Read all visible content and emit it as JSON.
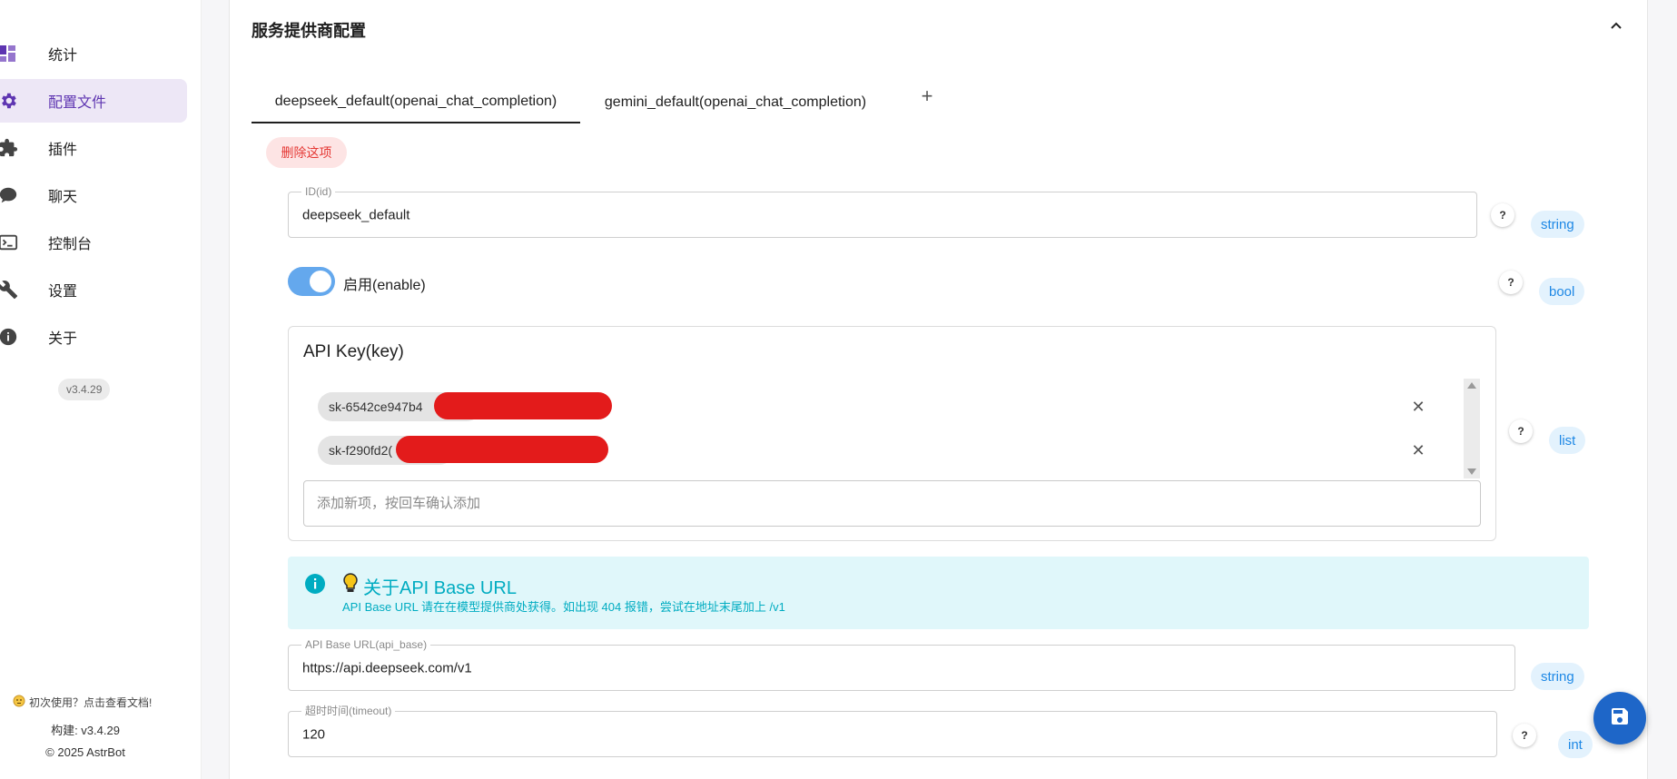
{
  "sidebar": {
    "items": [
      {
        "label": "统计",
        "icon": "dashboard-icon"
      },
      {
        "label": "配置文件",
        "icon": "gear-icon"
      },
      {
        "label": "插件",
        "icon": "puzzle-icon"
      },
      {
        "label": "聊天",
        "icon": "chat-bubble-icon"
      },
      {
        "label": "控制台",
        "icon": "terminal-icon"
      },
      {
        "label": "设置",
        "icon": "wrench-icon"
      },
      {
        "label": "关于",
        "icon": "info-icon"
      }
    ],
    "active_index": 1,
    "version": "v3.4.29",
    "footer_tip": "初次使用？点击查看文档!",
    "footer_build": "构建: v3.4.29",
    "footer_copyright": "© 2025 AstrBot"
  },
  "section": {
    "title": "服务提供商配置"
  },
  "tabs": [
    {
      "label": "deepseek_default(openai_chat_completion)",
      "active": true
    },
    {
      "label": "gemini_default(openai_chat_completion)",
      "active": false
    }
  ],
  "delete_label": "删除这项",
  "fields": {
    "id": {
      "label": "ID(id)",
      "value": "deepseek_default",
      "type": "string",
      "help": "?"
    },
    "enable": {
      "label": "启用(enable)",
      "value": true,
      "type": "bool",
      "help": "?"
    },
    "key": {
      "label": "API Key(key)",
      "items": [
        "sk-6542ce947b4",
        "sk-f290fd2("
      ],
      "add_placeholder": "添加新项，按回车确认添加",
      "type": "list",
      "help": "?"
    },
    "api_base": {
      "label": "API Base URL(api_base)",
      "value": "https://api.deepseek.com/v1",
      "type": "string"
    },
    "timeout": {
      "label": "超时时间(timeout)",
      "value": "120",
      "type": "int",
      "help": "?"
    }
  },
  "info": {
    "title": "关于API Base URL",
    "text": "API Base URL 请在在模型提供商处获得。如出现 404 报错，尝试在地址末尾加上 /v1"
  },
  "colors": {
    "accent_purple": "#5e35b1",
    "active_nav_bg": "#ede7f6",
    "chip_blue": "#1e88e5",
    "info_cyan": "#00acc1",
    "danger_red": "#e53935",
    "fab_blue": "#1e66c8"
  }
}
